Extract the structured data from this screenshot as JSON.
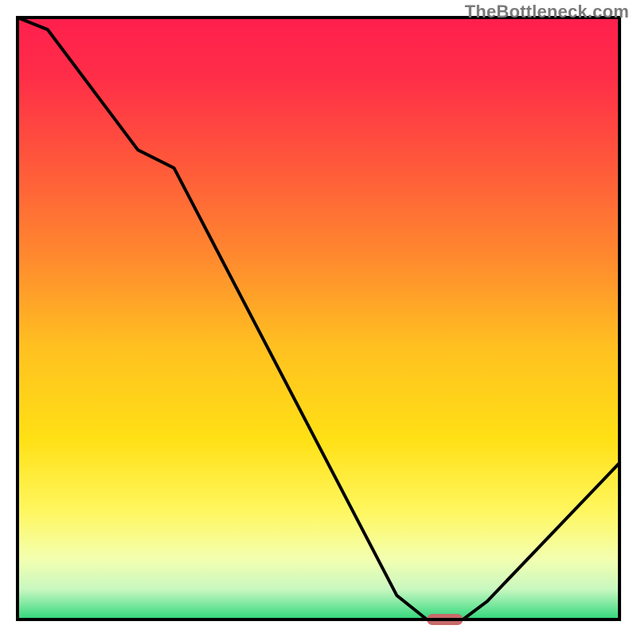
{
  "watermark": "TheBottleneck.com",
  "chart_data": {
    "type": "line",
    "title": "",
    "xlabel": "",
    "ylabel": "",
    "xlim": [
      0,
      100
    ],
    "ylim": [
      0,
      100
    ],
    "x": [
      0,
      5,
      20,
      26,
      63,
      68,
      74,
      78,
      100
    ],
    "values": [
      100,
      98,
      78,
      75,
      4,
      0,
      0,
      3,
      26
    ],
    "marker": {
      "x_start": 68,
      "x_end": 74,
      "y": 0
    },
    "background_gradient_stops": [
      {
        "offset": 0.0,
        "color": "#ff1f4d"
      },
      {
        "offset": 0.1,
        "color": "#ff2e48"
      },
      {
        "offset": 0.25,
        "color": "#ff5a3a"
      },
      {
        "offset": 0.4,
        "color": "#ff8a2e"
      },
      {
        "offset": 0.55,
        "color": "#ffc120"
      },
      {
        "offset": 0.7,
        "color": "#ffe015"
      },
      {
        "offset": 0.82,
        "color": "#fff760"
      },
      {
        "offset": 0.9,
        "color": "#f3ffb0"
      },
      {
        "offset": 0.95,
        "color": "#c8f7c0"
      },
      {
        "offset": 0.975,
        "color": "#7de8a0"
      },
      {
        "offset": 1.0,
        "color": "#2fd67a"
      }
    ],
    "marker_color": "#c96a6a",
    "curve_color": "#000000",
    "frame_color": "#000000"
  }
}
